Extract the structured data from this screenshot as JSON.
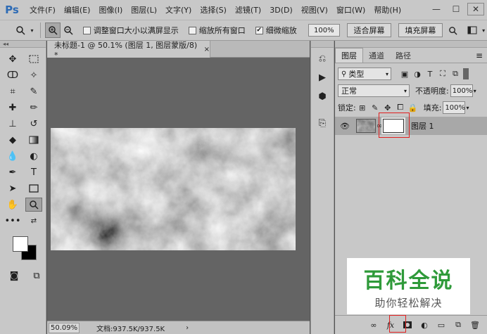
{
  "app": {
    "logo": "Ps"
  },
  "menu": [
    "文件(F)",
    "编辑(E)",
    "图像(I)",
    "图层(L)",
    "文字(Y)",
    "选择(S)",
    "滤镜(T)",
    "3D(D)",
    "视图(V)",
    "窗口(W)",
    "帮助(H)"
  ],
  "window_controls": {
    "minimize": "—",
    "maximize": "☐",
    "close": "✕"
  },
  "options": {
    "resize_windows": "调整窗口大小以满屏显示",
    "zoom_all_windows": "缩放所有窗口",
    "scrubby_zoom": "细微缩放",
    "zoom_value": "100%",
    "fit_screen": "适合屏幕",
    "fill_screen": "填充屏幕",
    "resize_windows_checked": false,
    "zoom_all_checked": false,
    "scrubby_checked": true
  },
  "document": {
    "tab_title": "未标题-1 @ 50.1% (图层 1, 图层蒙版/8) *",
    "tab_close": "×",
    "status_zoom": "50.09%",
    "status_doc": "文档:937.5K/937.5K",
    "status_arrow": "›"
  },
  "layers_panel": {
    "tabs": [
      "图层",
      "通道",
      "路径"
    ],
    "active_tab": 0,
    "menu_icon": "≡",
    "filter_kind": "类型",
    "blend_mode": "正常",
    "opacity_label": "不透明度:",
    "opacity_value": "100%",
    "lock_label": "锁定:",
    "fill_label": "填充:",
    "fill_value": "100%",
    "layer": {
      "name": "图层 1",
      "visible": true
    },
    "highlight_color": "#e02020"
  },
  "watermark": {
    "title": "百科全说",
    "subtitle": "助你轻松解决",
    "title_color": "#2f9a3a"
  },
  "colors": {
    "foreground": "#ffffff",
    "background": "#000000"
  }
}
